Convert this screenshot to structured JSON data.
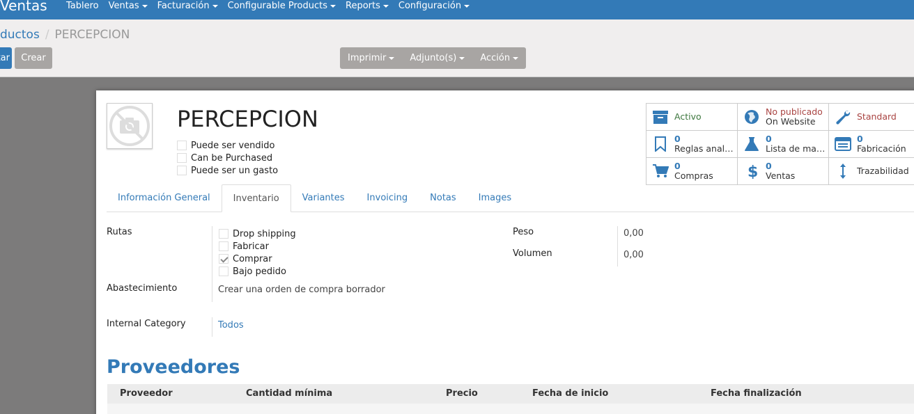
{
  "navbar": {
    "app_title": "Ventas",
    "menu": [
      "Tablero",
      "Ventas",
      "Facturación",
      "Configurable Products",
      "Reports",
      "Configuración"
    ]
  },
  "breadcrumb": {
    "parent": "Productos",
    "current": "PERCEPCION"
  },
  "buttons": {
    "edit": "Editar",
    "create": "Crear",
    "print": "Imprimir",
    "attachments": "Adjunto(s)",
    "action": "Acción"
  },
  "product": {
    "name": "PERCEPCION",
    "checkboxes": [
      {
        "label": "Puede ser vendido",
        "checked": false
      },
      {
        "label": "Can be Purchased",
        "checked": false
      },
      {
        "label": "Puede ser un gasto",
        "checked": false
      }
    ]
  },
  "smart_buttons": [
    {
      "icon": "archive-icon",
      "value": "",
      "label": "Activo",
      "tone": "green"
    },
    {
      "icon": "globe-icon",
      "value": "No publicado",
      "label": "On Website",
      "tone": "red"
    },
    {
      "icon": "wrench-icon",
      "value": "",
      "label": "Standard",
      "tone": "red"
    },
    {
      "icon": "bookmark-icon",
      "value": "0",
      "label": "Reglas analíticas",
      "tone": ""
    },
    {
      "icon": "flask-icon",
      "value": "0",
      "label": "Lista de materiales",
      "tone": ""
    },
    {
      "icon": "list-icon",
      "value": "0",
      "label": "Fabricación",
      "tone": ""
    },
    {
      "icon": "cart-icon",
      "value": "0",
      "label": "Compras",
      "tone": ""
    },
    {
      "icon": "dollar-icon",
      "value": "0",
      "label": "Ventas",
      "tone": ""
    },
    {
      "icon": "arrows-vertical-icon",
      "value": "",
      "label": "Trazabilidad",
      "tone": ""
    }
  ],
  "tabs": [
    {
      "label": "Información General",
      "active": false
    },
    {
      "label": "Inventario",
      "active": true
    },
    {
      "label": "Variantes",
      "active": false
    },
    {
      "label": "Invoicing",
      "active": false
    },
    {
      "label": "Notas",
      "active": false
    },
    {
      "label": "Images",
      "active": false
    }
  ],
  "inventory": {
    "routes_label": "Rutas",
    "routes": [
      {
        "label": "Drop shipping",
        "checked": false
      },
      {
        "label": "Fabricar",
        "checked": false
      },
      {
        "label": "Comprar",
        "checked": true
      },
      {
        "label": "Bajo pedido",
        "checked": false
      }
    ],
    "procurement_label": "Abastecimiento",
    "procurement_value": "Crear una orden de compra borrador",
    "category_label": "Internal Category",
    "category_value": "Todos",
    "weight_label": "Peso",
    "weight_value": "0,00",
    "volume_label": "Volumen",
    "volume_value": "0,00"
  },
  "vendors": {
    "title": "Proveedores",
    "columns": [
      "Proveedor",
      "Cantidad mínima",
      "Precio",
      "Fecha de inicio",
      "Fecha finalización"
    ]
  }
}
